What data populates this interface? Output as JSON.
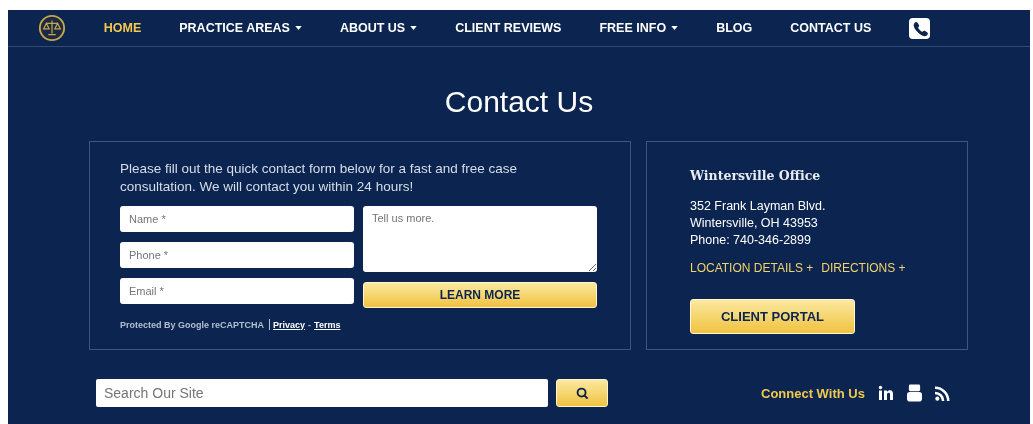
{
  "nav": {
    "items": [
      {
        "label": "HOME",
        "selected": true,
        "dropdown": false
      },
      {
        "label": "PRACTICE AREAS",
        "selected": false,
        "dropdown": true
      },
      {
        "label": "ABOUT US",
        "selected": false,
        "dropdown": true
      },
      {
        "label": "CLIENT REVIEWS",
        "selected": false,
        "dropdown": false
      },
      {
        "label": "FREE INFO",
        "selected": false,
        "dropdown": true
      },
      {
        "label": "BLOG",
        "selected": false,
        "dropdown": false
      },
      {
        "label": "CONTACT US",
        "selected": false,
        "dropdown": false
      }
    ]
  },
  "heading": "Contact Us",
  "form": {
    "intro": "Please fill out the quick contact form below for a fast and free case consultation. We will contact you within 24 hours!",
    "fields": [
      {
        "placeholder": "Name *"
      },
      {
        "placeholder": "Phone *"
      },
      {
        "placeholder": "Email *"
      }
    ],
    "message": {
      "placeholder": "Tell us more."
    },
    "submit": "LEARN MORE",
    "recaptcha": {
      "text": "Protected By Google reCAPTCHA",
      "links": [
        "Privacy",
        "Terms"
      ],
      "separator": "-"
    }
  },
  "office": {
    "title": "Wintersville Office",
    "lines": [
      "352 Frank Layman Blvd.",
      "Wintersville, OH 43953",
      "Phone: 740-346-2899"
    ],
    "links": [
      "LOCATION DETAILS +",
      "DIRECTIONS +"
    ],
    "button": "CLIENT PORTAL"
  },
  "search": {
    "placeholder": "Search Our Site"
  },
  "social": {
    "label": "Connect With Us",
    "icons": [
      {
        "kind": "linkedin"
      },
      {
        "kind": "youtube"
      },
      {
        "kind": "rss"
      }
    ]
  }
}
